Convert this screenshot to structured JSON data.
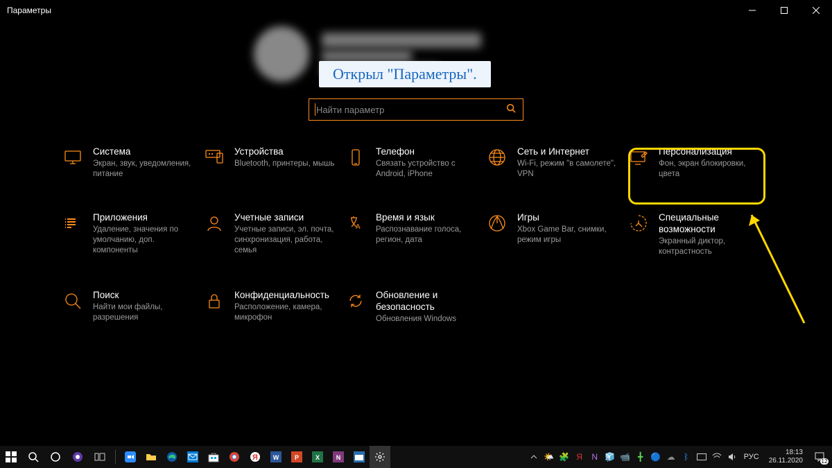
{
  "window": {
    "title": "Параметры"
  },
  "callout": "Открыл \"Параметры\".",
  "search": {
    "placeholder": "Найти параметр"
  },
  "categories": [
    {
      "title": "Система",
      "desc": "Экран, звук, уведомления, питание"
    },
    {
      "title": "Устройства",
      "desc": "Bluetooth, принтеры, мышь"
    },
    {
      "title": "Телефон",
      "desc": "Связать устройство с Android, iPhone"
    },
    {
      "title": "Сеть и Интернет",
      "desc": "Wi-Fi, режим \"в самолете\", VPN"
    },
    {
      "title": "Персонализация",
      "desc": "Фон, экран блокировки, цвета"
    },
    {
      "title": "Приложения",
      "desc": "Удаление, значения по умолчанию, доп. компоненты"
    },
    {
      "title": "Учетные записи",
      "desc": "Учетные записи, эл. почта, синхронизация, работа, семья"
    },
    {
      "title": "Время и язык",
      "desc": "Распознавание голоса, регион, дата"
    },
    {
      "title": "Игры",
      "desc": "Xbox Game Bar, снимки, режим игры"
    },
    {
      "title": "Специальные возможности",
      "desc": "Экранный диктор, контрастность"
    },
    {
      "title": "Поиск",
      "desc": "Найти мои файлы, разрешения"
    },
    {
      "title": "Конфиденциальность",
      "desc": "Расположение, камера, микрофон"
    },
    {
      "title": "Обновление и безопасность",
      "desc": "Обновления Windows"
    }
  ],
  "taskbar": {
    "lang": "РУС",
    "time": "18:13",
    "date": "26.11.2020",
    "notif_count": "12"
  }
}
